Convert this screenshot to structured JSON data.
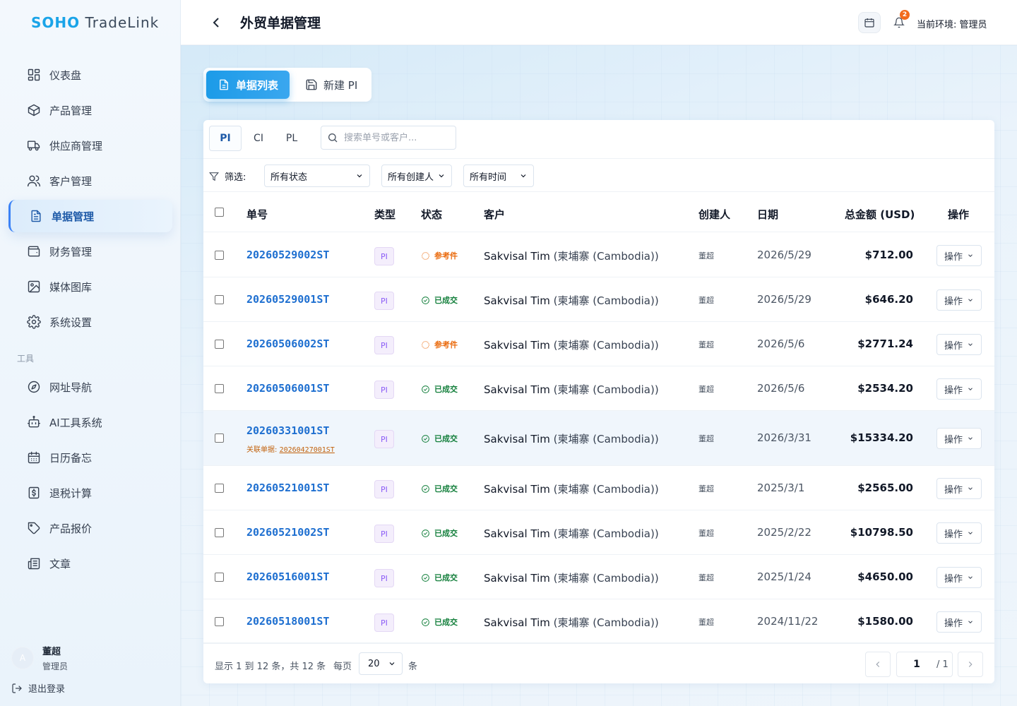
{
  "app": {
    "brand": "SOHO",
    "brand_rest": " TradeLink"
  },
  "sidebar": {
    "items": [
      {
        "label": "仪表盘",
        "icon": "dashboard-icon"
      },
      {
        "label": "产品管理",
        "icon": "box-icon"
      },
      {
        "label": "供应商管理",
        "icon": "truck-icon"
      },
      {
        "label": "客户管理",
        "icon": "users-icon"
      },
      {
        "label": "单据管理",
        "icon": "document-icon",
        "active": true
      },
      {
        "label": "财务管理",
        "icon": "wallet-icon"
      },
      {
        "label": "媒体图库",
        "icon": "image-icon"
      },
      {
        "label": "系统设置",
        "icon": "gear-icon"
      }
    ],
    "tools_label": "工具",
    "tools": [
      {
        "label": "网址导航",
        "icon": "compass-icon"
      },
      {
        "label": "AI工具系统",
        "icon": "bot-icon"
      },
      {
        "label": "日历备忘",
        "icon": "calendar-icon"
      },
      {
        "label": "退税计算",
        "icon": "dollar-icon"
      },
      {
        "label": "产品报价",
        "icon": "tag-icon"
      },
      {
        "label": "文章",
        "icon": "newspaper-icon"
      }
    ],
    "user": {
      "avatar": "A",
      "name": "董超",
      "role": "管理员"
    },
    "logout_label": "退出登录"
  },
  "header": {
    "title": "外贸单据管理",
    "notification_count": "2",
    "env_label": "当前环境: 管理员"
  },
  "main_tabs": {
    "list": "单据列表",
    "new": "新建 PI"
  },
  "doc_tabs": [
    "PI",
    "CI",
    "PL"
  ],
  "search": {
    "placeholder": "搜索单号或客户..."
  },
  "filters": {
    "label": "筛选:",
    "status": "所有状态",
    "creator": "所有创建人",
    "time": "所有时间"
  },
  "table": {
    "headers": {
      "no": "单号",
      "type": "类型",
      "status": "状态",
      "customer": "客户",
      "creator": "创建人",
      "date": "日期",
      "amount": "总金额 (USD)",
      "op": "操作"
    },
    "linked_label": "关联单据:",
    "op_label": "操作",
    "rows": [
      {
        "no": "20260529002ST",
        "type": "PI",
        "status": "参考件",
        "status_kind": "ref",
        "customer": "Sakvisal Tim",
        "country": "(柬埔寨 (Cambodia))",
        "creator": "董超",
        "date": "2026/5/29",
        "amount": "$712.00"
      },
      {
        "no": "20260529001ST",
        "type": "PI",
        "status": "已成交",
        "status_kind": "ok",
        "customer": "Sakvisal Tim",
        "country": "(柬埔寨 (Cambodia))",
        "creator": "董超",
        "date": "2026/5/29",
        "amount": "$646.20"
      },
      {
        "no": "20260506002ST",
        "type": "PI",
        "status": "参考件",
        "status_kind": "ref",
        "customer": "Sakvisal Tim",
        "country": "(柬埔寨 (Cambodia))",
        "creator": "董超",
        "date": "2026/5/6",
        "amount": "$2771.24"
      },
      {
        "no": "20260506001ST",
        "type": "PI",
        "status": "已成交",
        "status_kind": "ok",
        "customer": "Sakvisal Tim",
        "country": "(柬埔寨 (Cambodia))",
        "creator": "董超",
        "date": "2026/5/6",
        "amount": "$2534.20"
      },
      {
        "no": "20260331001ST",
        "linked": "20260427001ST",
        "type": "PI",
        "status": "已成交",
        "status_kind": "ok",
        "customer": "Sakvisal Tim",
        "country": "(柬埔寨 (Cambodia))",
        "creator": "董超",
        "date": "2026/3/31",
        "amount": "$15334.20"
      },
      {
        "no": "20260521001ST",
        "type": "PI",
        "status": "已成交",
        "status_kind": "ok",
        "customer": "Sakvisal Tim",
        "country": "(柬埔寨 (Cambodia))",
        "creator": "董超",
        "date": "2025/3/1",
        "amount": "$2565.00"
      },
      {
        "no": "20260521002ST",
        "type": "PI",
        "status": "已成交",
        "status_kind": "ok",
        "customer": "Sakvisal Tim",
        "country": "(柬埔寨 (Cambodia))",
        "creator": "董超",
        "date": "2025/2/22",
        "amount": "$10798.50"
      },
      {
        "no": "20260516001ST",
        "type": "PI",
        "status": "已成交",
        "status_kind": "ok",
        "customer": "Sakvisal Tim",
        "country": "(柬埔寨 (Cambodia))",
        "creator": "董超",
        "date": "2025/1/24",
        "amount": "$4650.00"
      },
      {
        "no": "20260518001ST",
        "type": "PI",
        "status": "已成交",
        "status_kind": "ok",
        "customer": "Sakvisal Tim",
        "country": "(柬埔寨 (Cambodia))",
        "creator": "董超",
        "date": "2024/11/22",
        "amount": "$1580.00"
      }
    ]
  },
  "footer": {
    "summary": "显示 1 到 12 条，共 12 条",
    "per_page_label": "每页",
    "per_page_value": "20",
    "unit": "条",
    "current_page": "1",
    "total_pages": "/ 1"
  }
}
